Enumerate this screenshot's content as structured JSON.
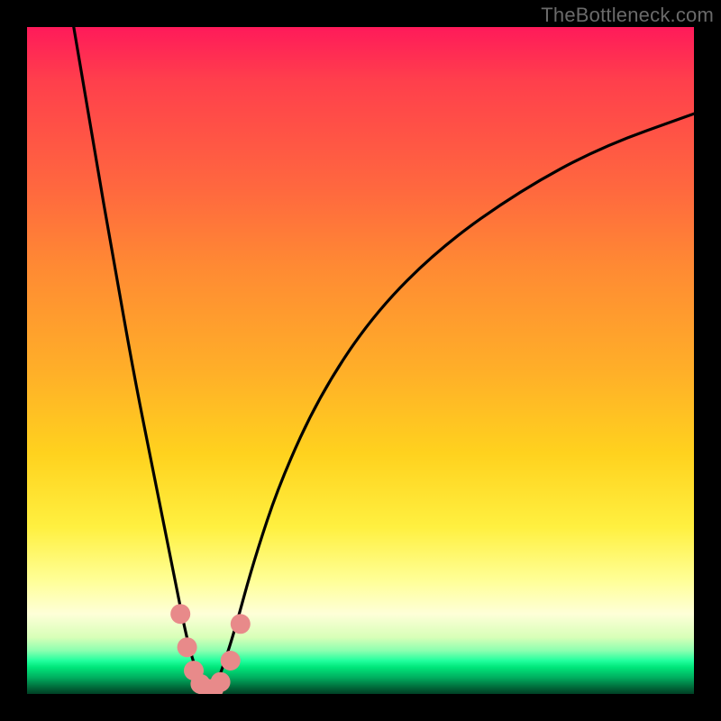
{
  "watermark": "TheBottleneck.com",
  "chart_data": {
    "type": "line",
    "title": "",
    "xlabel": "",
    "ylabel": "",
    "xlim": [
      0,
      100
    ],
    "ylim": [
      0,
      100
    ],
    "grid": false,
    "legend": false,
    "series": [
      {
        "name": "bottleneck-curve",
        "x": [
          7,
          10,
          13,
          16,
          19,
          22,
          24,
          25.5,
          27,
          28,
          29,
          31,
          34,
          38,
          44,
          52,
          62,
          74,
          86,
          100
        ],
        "values": [
          100,
          82,
          65,
          48,
          33,
          18,
          8,
          3,
          0.5,
          0.5,
          3,
          9,
          20,
          32,
          45,
          57,
          67,
          75.5,
          82,
          87
        ]
      }
    ],
    "markers": {
      "name": "highlight-dots",
      "color": "#e88a8a",
      "points": [
        {
          "x": 23.0,
          "y": 12.0
        },
        {
          "x": 24.0,
          "y": 7.0
        },
        {
          "x": 25.0,
          "y": 3.5
        },
        {
          "x": 26.0,
          "y": 1.5
        },
        {
          "x": 27.0,
          "y": 0.8
        },
        {
          "x": 28.0,
          "y": 0.8
        },
        {
          "x": 29.0,
          "y": 1.8
        },
        {
          "x": 30.5,
          "y": 5.0
        },
        {
          "x": 32.0,
          "y": 10.5
        }
      ]
    },
    "background_gradient": {
      "top": "#ff1a5a",
      "mid": "#ffd21e",
      "band": "#22ff9e",
      "bottom": "#003f24"
    }
  }
}
